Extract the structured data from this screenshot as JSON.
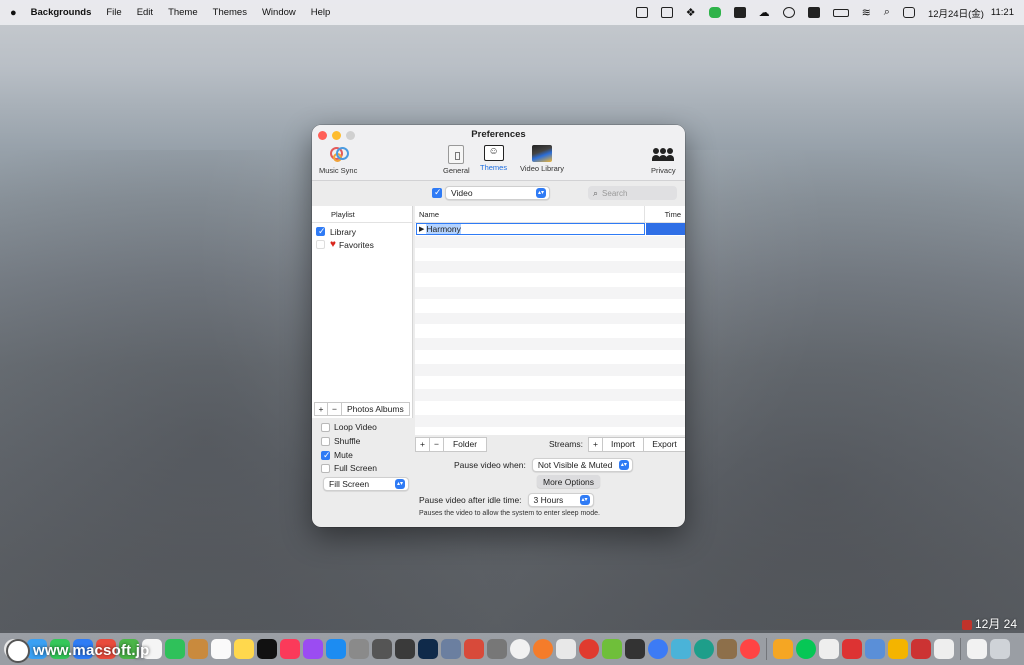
{
  "menubar": {
    "app_name": "Backgrounds",
    "items": [
      "File",
      "Edit",
      "Theme",
      "Themes",
      "Window",
      "Help"
    ],
    "date": "12月24日(金)",
    "time": "11:21"
  },
  "window": {
    "title": "Preferences",
    "toolbar": {
      "music_sync": "Music Sync",
      "general": "General",
      "themes": "Themes",
      "video_library": "Video Library",
      "privacy": "Privacy"
    },
    "filter": {
      "type_value": "Video",
      "search_placeholder": "Search"
    },
    "playlist": {
      "header": "Playlist",
      "items": [
        {
          "label": "Library",
          "checked": true
        },
        {
          "label": "Favorites",
          "checked": false
        }
      ],
      "add": "+",
      "remove": "−",
      "photos_albums": "Photos Albums"
    },
    "list": {
      "col_name": "Name",
      "col_time": "Time",
      "selected_item": "Harmony",
      "add": "+",
      "remove": "−",
      "folder": "Folder",
      "streams_label": "Streams:",
      "streams_add": "+",
      "import": "Import",
      "export": "Export"
    },
    "options": {
      "loop_video": "Loop Video",
      "shuffle": "Shuffle",
      "mute": "Mute",
      "full_screen": "Full Screen",
      "screen_mode": "Fill Screen"
    },
    "pause": {
      "when_label": "Pause video when:",
      "when_value": "Not Visible & Muted",
      "more_options": "More Options",
      "idle_label": "Pause video after idle time:",
      "idle_value": "3 Hours",
      "note": "Pauses the video to allow the system to enter sleep mode."
    }
  },
  "desktop": {
    "watermark": "www.macsoft.jp",
    "widget_date": "12月 24"
  },
  "colors": {
    "accent": "#2f7bf5",
    "selection": "#2f6fe6",
    "favorite_heart": "#d9261c"
  }
}
